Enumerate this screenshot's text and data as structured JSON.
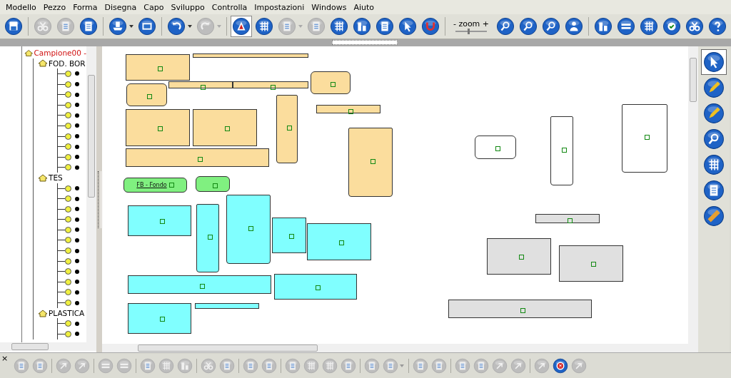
{
  "menu": [
    "Modello",
    "Pezzo",
    "Forma",
    "Disegna",
    "Capo",
    "Sviluppo",
    "Controlla",
    "Impostazioni",
    "Windows",
    "Aiuto"
  ],
  "toolbar": [
    {
      "kind": "button",
      "disabled": false,
      "pressed": false,
      "dropdown": false
    },
    {
      "kind": "separator"
    },
    {
      "kind": "button",
      "disabled": true,
      "pressed": false,
      "dropdown": false
    },
    {
      "kind": "button",
      "disabled": true,
      "pressed": false,
      "dropdown": false
    },
    {
      "kind": "button",
      "disabled": false,
      "pressed": false,
      "dropdown": false
    },
    {
      "kind": "separator"
    },
    {
      "kind": "button",
      "disabled": false,
      "pressed": false,
      "dropdown": true
    },
    {
      "kind": "button",
      "disabled": false,
      "pressed": false,
      "dropdown": false
    },
    {
      "kind": "separator"
    },
    {
      "kind": "button",
      "disabled": false,
      "pressed": false,
      "dropdown": true
    },
    {
      "kind": "button",
      "disabled": true,
      "pressed": false,
      "dropdown": true
    },
    {
      "kind": "separator"
    },
    {
      "kind": "button",
      "disabled": false,
      "pressed": true,
      "dropdown": false
    },
    {
      "kind": "button",
      "disabled": false,
      "pressed": false,
      "dropdown": false
    },
    {
      "kind": "button",
      "disabled": true,
      "pressed": false,
      "dropdown": true
    },
    {
      "kind": "button",
      "disabled": true,
      "pressed": false,
      "dropdown": false
    },
    {
      "kind": "button",
      "disabled": false,
      "pressed": false,
      "dropdown": false
    },
    {
      "kind": "button",
      "disabled": false,
      "pressed": false,
      "dropdown": false
    },
    {
      "kind": "button",
      "disabled": false,
      "pressed": false,
      "dropdown": false
    },
    {
      "kind": "button",
      "disabled": false,
      "pressed": false,
      "dropdown": false
    },
    {
      "kind": "button",
      "disabled": false,
      "pressed": false,
      "dropdown": false
    },
    {
      "kind": "separator"
    },
    {
      "kind": "zoom",
      "label": "- zoom +",
      "level": 0.4
    },
    {
      "kind": "button",
      "disabled": false,
      "pressed": false,
      "dropdown": false
    },
    {
      "kind": "button",
      "disabled": false,
      "pressed": false,
      "dropdown": false
    },
    {
      "kind": "button",
      "disabled": false,
      "pressed": false,
      "dropdown": false
    },
    {
      "kind": "button",
      "disabled": false,
      "pressed": false,
      "dropdown": false
    },
    {
      "kind": "separator"
    },
    {
      "kind": "button",
      "disabled": false,
      "pressed": false,
      "dropdown": false
    },
    {
      "kind": "button",
      "disabled": false,
      "pressed": false,
      "dropdown": false
    },
    {
      "kind": "button",
      "disabled": false,
      "pressed": false,
      "dropdown": false
    },
    {
      "kind": "button",
      "disabled": false,
      "pressed": false,
      "dropdown": false
    },
    {
      "kind": "button",
      "disabled": false,
      "pressed": false,
      "dropdown": false
    },
    {
      "kind": "button",
      "disabled": false,
      "pressed": false,
      "dropdown": false
    }
  ],
  "tree": {
    "label": "Campione00 -",
    "children": [
      {
        "label": "FOD. BOR",
        "children": [
          {
            "kind": "piece"
          },
          {
            "kind": "piece"
          },
          {
            "kind": "piece"
          },
          {
            "kind": "piece"
          },
          {
            "kind": "piece"
          },
          {
            "kind": "piece"
          },
          {
            "kind": "piece"
          },
          {
            "kind": "piece"
          },
          {
            "kind": "piece"
          },
          {
            "kind": "piece"
          }
        ]
      },
      {
        "label": "TES",
        "children": [
          {
            "kind": "piece"
          },
          {
            "kind": "piece"
          },
          {
            "kind": "piece"
          },
          {
            "kind": "piece"
          },
          {
            "kind": "piece"
          },
          {
            "kind": "piece"
          },
          {
            "kind": "piece"
          },
          {
            "kind": "piece"
          },
          {
            "kind": "piece"
          },
          {
            "kind": "piece"
          },
          {
            "kind": "piece"
          },
          {
            "kind": "piece"
          }
        ]
      },
      {
        "label": "PLASTICA",
        "children": [
          {
            "kind": "piece"
          },
          {
            "kind": "piece"
          }
        ]
      }
    ]
  },
  "pieces": [
    {
      "color": "#fbdd9d"
    },
    {
      "color": "#fbdd9d"
    },
    {
      "color": "#fbdd9d"
    },
    {
      "color": "#fbdd9d"
    },
    {
      "color": "#fbdd9d"
    },
    {
      "color": "#fbdd9d"
    },
    {
      "color": "#fbdd9d"
    },
    {
      "color": "#fbdd9d"
    },
    {
      "color": "#fbdd9d"
    },
    {
      "color": "#fbdd9d"
    },
    {
      "color": "#fbdd9d"
    },
    {
      "color": "#fbdd9d"
    },
    {
      "color": "#80f080",
      "label": "FB - Fondo"
    },
    {
      "color": "#80f080"
    },
    {
      "color": "#80ffff"
    },
    {
      "color": "#80ffff"
    },
    {
      "color": "#80ffff"
    },
    {
      "color": "#80ffff"
    },
    {
      "color": "#80ffff"
    },
    {
      "color": "#80ffff"
    },
    {
      "color": "#80ffff"
    },
    {
      "color": "#80ffff"
    },
    {
      "color": "#80ffff"
    },
    {
      "color": "#ffffff"
    },
    {
      "color": "#ffffff"
    },
    {
      "color": "#ffffff"
    },
    {
      "color": "#e0e0e0"
    },
    {
      "color": "#e0e0e0"
    },
    {
      "color": "#e0e0e0"
    },
    {
      "color": "#e0e0e0"
    }
  ],
  "right_toolbar": [
    {
      "selected": true
    },
    {
      "selected": false
    },
    {
      "selected": false
    },
    {
      "selected": false
    },
    {
      "selected": false
    },
    {
      "selected": false
    },
    {
      "selected": false
    }
  ],
  "bottom_toolbar": {
    "close": "×",
    "items": [
      {
        "kind": "button",
        "disabled": true,
        "dropdown": false
      },
      {
        "kind": "button",
        "disabled": true,
        "dropdown": false
      },
      {
        "kind": "separator"
      },
      {
        "kind": "button",
        "disabled": true,
        "dropdown": false
      },
      {
        "kind": "button",
        "disabled": true,
        "dropdown": false
      },
      {
        "kind": "separator"
      },
      {
        "kind": "button",
        "disabled": true,
        "dropdown": false
      },
      {
        "kind": "button",
        "disabled": true,
        "dropdown": false
      },
      {
        "kind": "separator"
      },
      {
        "kind": "button",
        "disabled": true,
        "dropdown": false
      },
      {
        "kind": "button",
        "disabled": true,
        "dropdown": false
      },
      {
        "kind": "button",
        "disabled": true,
        "dropdown": false
      },
      {
        "kind": "separator"
      },
      {
        "kind": "button",
        "disabled": true,
        "dropdown": false
      },
      {
        "kind": "button",
        "disabled": true,
        "dropdown": false
      },
      {
        "kind": "separator"
      },
      {
        "kind": "button",
        "disabled": true,
        "dropdown": false
      },
      {
        "kind": "button",
        "disabled": true,
        "dropdown": false
      },
      {
        "kind": "separator"
      },
      {
        "kind": "button",
        "disabled": true,
        "dropdown": false
      },
      {
        "kind": "button",
        "disabled": true,
        "dropdown": false
      },
      {
        "kind": "button",
        "disabled": true,
        "dropdown": false
      },
      {
        "kind": "button",
        "disabled": true,
        "dropdown": false
      },
      {
        "kind": "separator"
      },
      {
        "kind": "button",
        "disabled": true,
        "dropdown": false
      },
      {
        "kind": "button",
        "disabled": true,
        "dropdown": true
      },
      {
        "kind": "separator"
      },
      {
        "kind": "button",
        "disabled": true,
        "dropdown": false
      },
      {
        "kind": "button",
        "disabled": true,
        "dropdown": false
      },
      {
        "kind": "separator"
      },
      {
        "kind": "button",
        "disabled": true,
        "dropdown": false
      },
      {
        "kind": "button",
        "disabled": true,
        "dropdown": false
      },
      {
        "kind": "button",
        "disabled": true,
        "dropdown": false
      },
      {
        "kind": "button",
        "disabled": true,
        "dropdown": false
      },
      {
        "kind": "separator"
      },
      {
        "kind": "button",
        "disabled": true,
        "dropdown": false
      },
      {
        "kind": "button",
        "disabled": false,
        "dropdown": false
      },
      {
        "kind": "button",
        "disabled": true,
        "dropdown": false
      }
    ]
  }
}
